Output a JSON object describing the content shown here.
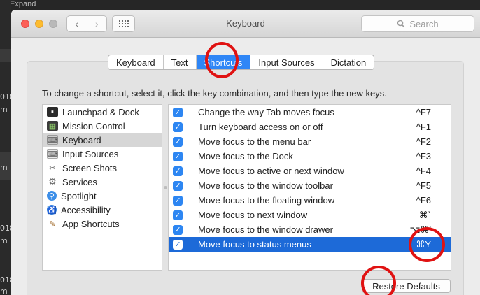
{
  "background": {
    "top_text": "Expand",
    "side_labels": [
      "018",
      "m",
      "m",
      "018",
      "m",
      "018",
      "m"
    ]
  },
  "window": {
    "title": "Keyboard",
    "nav_back": "‹",
    "nav_forward": "›",
    "search_placeholder": "Search"
  },
  "tabs": [
    {
      "label": "Keyboard",
      "active": false
    },
    {
      "label": "Text",
      "active": false
    },
    {
      "label": "Shortcuts",
      "active": true
    },
    {
      "label": "Input Sources",
      "active": false
    },
    {
      "label": "Dictation",
      "active": false
    }
  ],
  "instructions": "To change a shortcut, select it, click the key combination, and then type the new keys.",
  "categories": [
    {
      "label": "Launchpad & Dock",
      "icon": "launchpad-icon",
      "selected": false
    },
    {
      "label": "Mission Control",
      "icon": "mission-control-icon",
      "selected": false
    },
    {
      "label": "Keyboard",
      "icon": "keyboard-icon",
      "selected": true
    },
    {
      "label": "Input Sources",
      "icon": "input-sources-icon",
      "selected": false
    },
    {
      "label": "Screen Shots",
      "icon": "screen-shots-icon",
      "selected": false
    },
    {
      "label": "Services",
      "icon": "services-icon",
      "selected": false
    },
    {
      "label": "Spotlight",
      "icon": "spotlight-icon",
      "selected": false
    },
    {
      "label": "Accessibility",
      "icon": "accessibility-icon",
      "selected": false
    },
    {
      "label": "App Shortcuts",
      "icon": "app-shortcuts-icon",
      "selected": false
    }
  ],
  "shortcuts": [
    {
      "label": "Change the way Tab moves focus",
      "key": "^F7",
      "checked": true,
      "selected": false
    },
    {
      "label": "Turn keyboard access on or off",
      "key": "^F1",
      "checked": true,
      "selected": false
    },
    {
      "label": "Move focus to the menu bar",
      "key": "^F2",
      "checked": true,
      "selected": false
    },
    {
      "label": "Move focus to the Dock",
      "key": "^F3",
      "checked": true,
      "selected": false
    },
    {
      "label": "Move focus to active or next window",
      "key": "^F4",
      "checked": true,
      "selected": false
    },
    {
      "label": "Move focus to the window toolbar",
      "key": "^F5",
      "checked": true,
      "selected": false
    },
    {
      "label": "Move focus to the floating window",
      "key": "^F6",
      "checked": true,
      "selected": false
    },
    {
      "label": "Move focus to next window",
      "key": "⌘`",
      "checked": true,
      "selected": false
    },
    {
      "label": "Move focus to the window drawer",
      "key": "⌥⌘'",
      "checked": true,
      "selected": false
    },
    {
      "label": "Move focus to status menus",
      "key": "⌘Y",
      "checked": true,
      "selected": true
    }
  ],
  "restore_label": "Restore Defaults",
  "colors": {
    "accent": "#2f86f6",
    "selection": "#1d6ad8",
    "annotation": "#e01212"
  }
}
